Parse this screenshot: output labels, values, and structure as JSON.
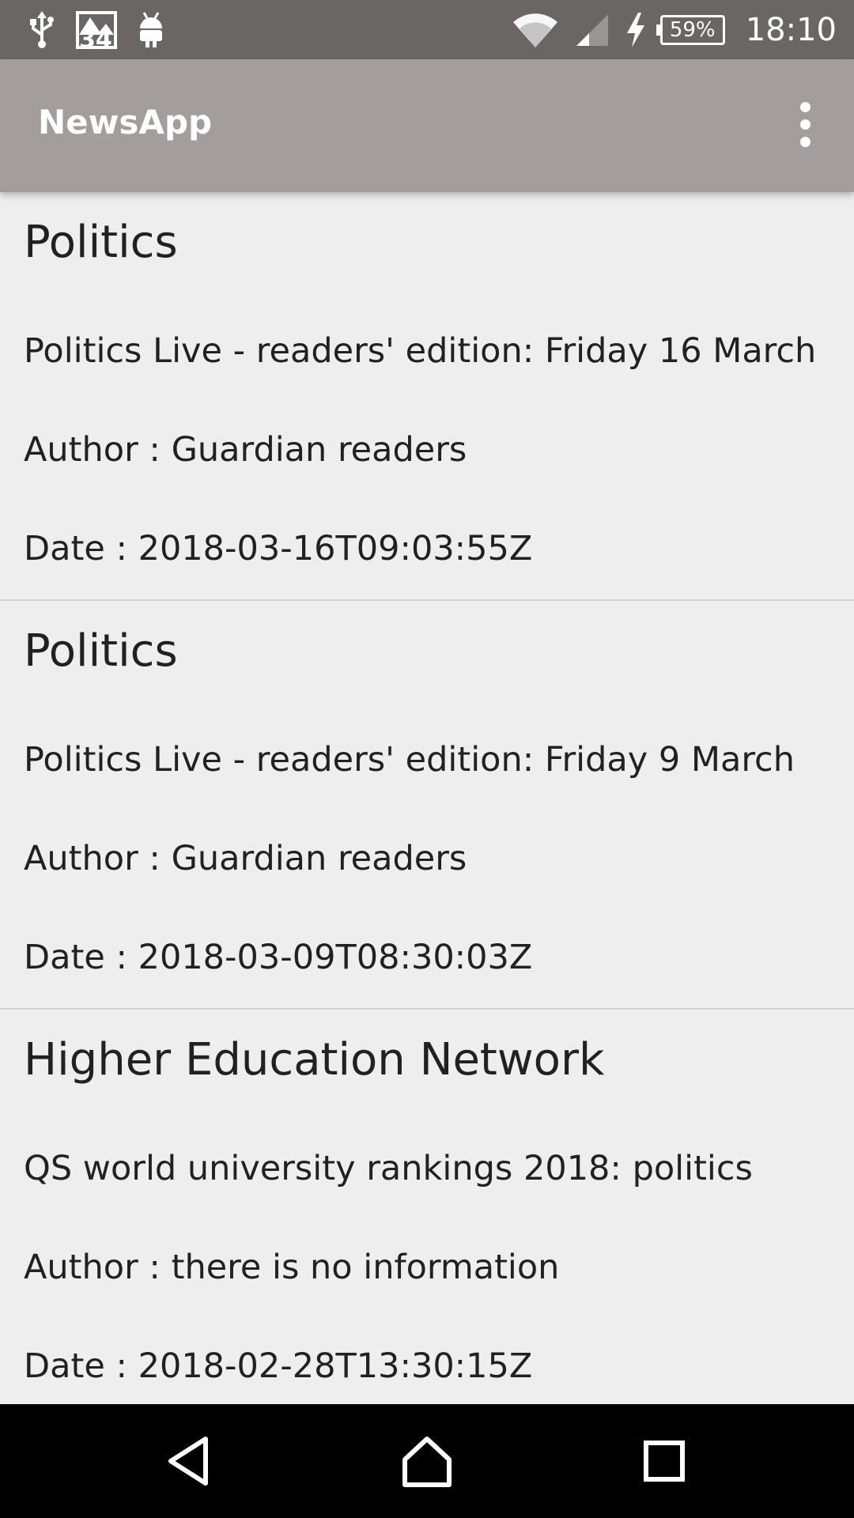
{
  "status_bar": {
    "notification_count": "34",
    "battery_percent": "59%",
    "time": "18:10"
  },
  "app_bar": {
    "title": "NewsApp"
  },
  "articles": [
    {
      "section": "Politics",
      "title": "Politics Live - readers' edition: Friday 16 March",
      "author": "Author : Guardian readers",
      "date": "Date : 2018-03-16T09:03:55Z"
    },
    {
      "section": "Politics",
      "title": "Politics Live - readers' edition: Friday 9 March",
      "author": "Author : Guardian readers",
      "date": "Date : 2018-03-09T08:30:03Z"
    },
    {
      "section": "Higher Education Network",
      "title": "QS world university rankings 2018: politics",
      "author": "Author : there is no information",
      "date": "Date : 2018-02-28T13:30:15Z"
    }
  ],
  "icons": {
    "status_left": [
      "usb-icon",
      "notification-image-icon",
      "android-icon"
    ],
    "status_right": [
      "wifi-icon",
      "cell-signal-icon",
      "charging-bolt-icon",
      "battery-icon"
    ],
    "app_bar": [
      "overflow-menu-icon"
    ],
    "nav": [
      "back-icon",
      "home-icon",
      "recents-icon"
    ]
  },
  "colors": {
    "status_bar": "#6b6666",
    "app_bar": "#a39d9d",
    "background": "#eeeeee",
    "nav_bar": "#000000"
  }
}
